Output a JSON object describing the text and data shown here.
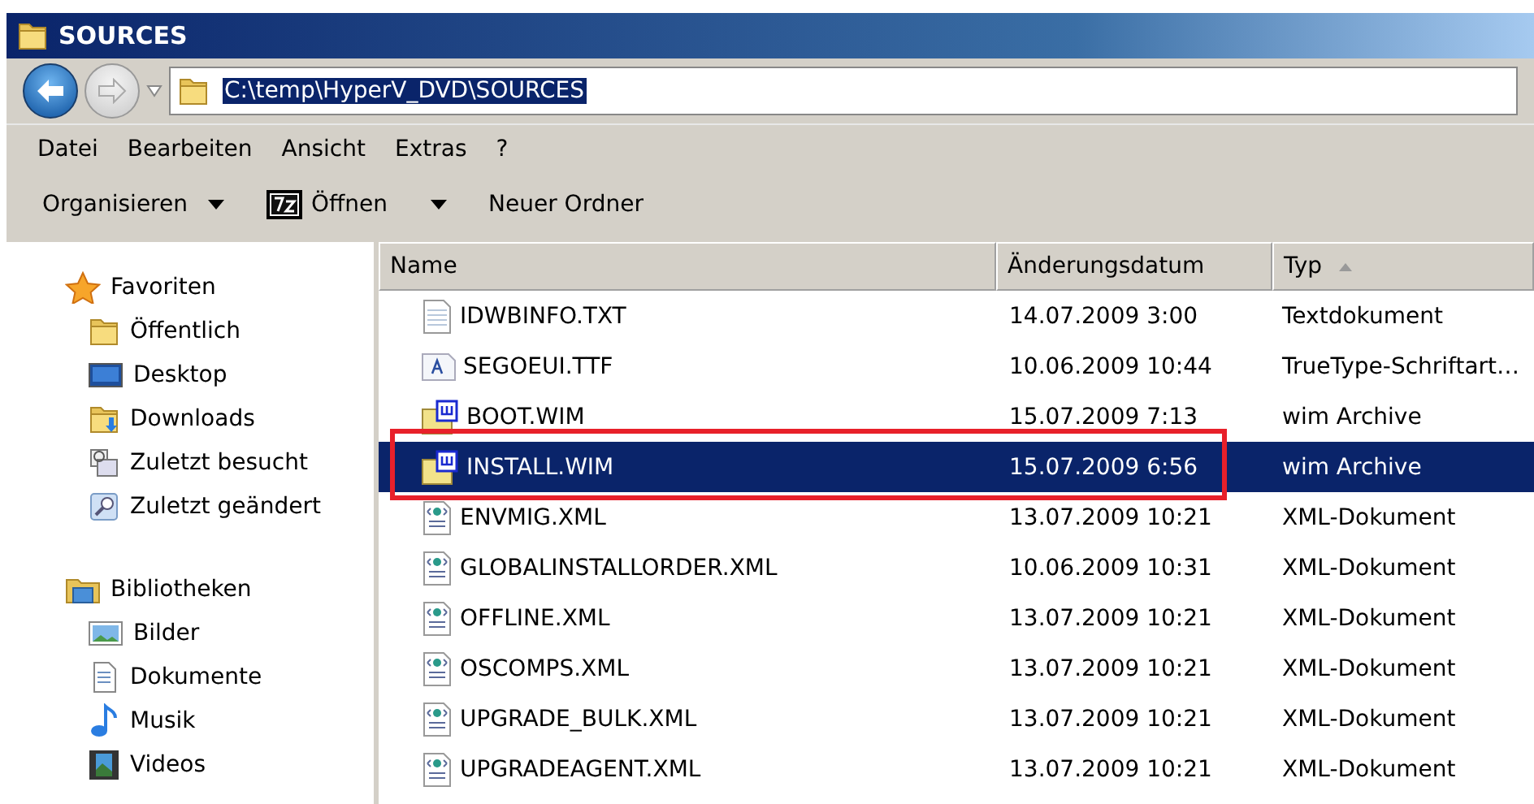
{
  "window": {
    "title": "SOURCES"
  },
  "address": {
    "path": "C:\\temp\\HyperV_DVD\\SOURCES"
  },
  "menu": [
    "Datei",
    "Bearbeiten",
    "Ansicht",
    "Extras",
    "?"
  ],
  "toolbar": [
    {
      "label": "Organisieren",
      "kind": "dropdown"
    },
    {
      "label": "Öffnen",
      "kind": "sevenzip"
    },
    {
      "label": "Neuer Ordner",
      "kind": "plain"
    }
  ],
  "sidebar": {
    "groups": [
      {
        "label": "Favoriten",
        "kind": "star",
        "items": [
          {
            "label": "Öffentlich",
            "kind": "folder"
          },
          {
            "label": "Desktop",
            "kind": "desktop"
          },
          {
            "label": "Downloads",
            "kind": "downloads"
          },
          {
            "label": "Zuletzt besucht",
            "kind": "recent"
          },
          {
            "label": "Zuletzt geändert",
            "kind": "search"
          }
        ]
      },
      {
        "label": "Bibliotheken",
        "kind": "library",
        "items": [
          {
            "label": "Bilder",
            "kind": "pictures"
          },
          {
            "label": "Dokumente",
            "kind": "documents"
          },
          {
            "label": "Musik",
            "kind": "music"
          },
          {
            "label": "Videos",
            "kind": "videos"
          }
        ]
      }
    ]
  },
  "table": {
    "columns": [
      {
        "label": "Name",
        "sorted": false
      },
      {
        "label": "Änderungsdatum",
        "sorted": false
      },
      {
        "label": "Typ",
        "sorted": true
      }
    ],
    "rows": [
      {
        "name": "IDWBINFO.TXT",
        "date": "14.07.2009 3:00",
        "type": "Textdokument",
        "kind": "text",
        "selected": false,
        "annotated": false
      },
      {
        "name": "SEGOEUI.TTF",
        "date": "10.06.2009 10:44",
        "type": "TrueType-Schriftart…",
        "kind": "font",
        "selected": false,
        "annotated": false
      },
      {
        "name": "BOOT.WIM",
        "date": "15.07.2009 7:13",
        "type": "wim Archive",
        "kind": "wim",
        "selected": false,
        "annotated": false
      },
      {
        "name": "INSTALL.WIM",
        "date": "15.07.2009 6:56",
        "type": "wim Archive",
        "kind": "wim",
        "selected": true,
        "annotated": true
      },
      {
        "name": "ENVMIG.XML",
        "date": "13.07.2009 10:21",
        "type": "XML-Dokument",
        "kind": "xml",
        "selected": false,
        "annotated": false
      },
      {
        "name": "GLOBALINSTALLORDER.XML",
        "date": "10.06.2009 10:31",
        "type": "XML-Dokument",
        "kind": "xml",
        "selected": false,
        "annotated": false
      },
      {
        "name": "OFFLINE.XML",
        "date": "13.07.2009 10:21",
        "type": "XML-Dokument",
        "kind": "xml",
        "selected": false,
        "annotated": false
      },
      {
        "name": "OSCOMPS.XML",
        "date": "13.07.2009 10:21",
        "type": "XML-Dokument",
        "kind": "xml",
        "selected": false,
        "annotated": false
      },
      {
        "name": "UPGRADE_BULK.XML",
        "date": "13.07.2009 10:21",
        "type": "XML-Dokument",
        "kind": "xml",
        "selected": false,
        "annotated": false
      },
      {
        "name": "UPGRADEAGENT.XML",
        "date": "13.07.2009 10:21",
        "type": "XML-Dokument",
        "kind": "xml",
        "selected": false,
        "annotated": false
      }
    ]
  }
}
